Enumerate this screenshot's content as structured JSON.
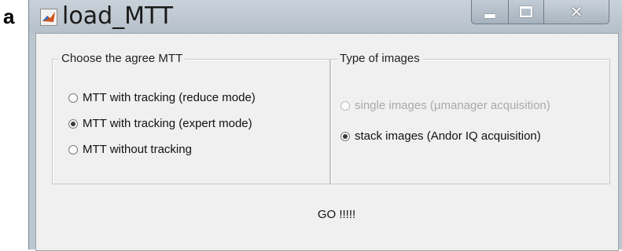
{
  "figure": {
    "panel_label": "a"
  },
  "window": {
    "title": "load_MTT"
  },
  "controls": {
    "minimize_icon": "minimize-icon",
    "maximize_icon": "maximize-icon",
    "close_icon": "close-icon"
  },
  "groups": {
    "mtt": {
      "legend": "Choose the agree MTT",
      "options": [
        {
          "label": "MTT with tracking (reduce mode)",
          "selected": false,
          "enabled": true
        },
        {
          "label": "MTT with tracking (expert mode)",
          "selected": true,
          "enabled": true
        },
        {
          "label": "MTT without tracking",
          "selected": false,
          "enabled": true
        }
      ]
    },
    "images": {
      "legend": "Type of images",
      "options": [
        {
          "label": "single images (µmanager acquisition)",
          "selected": false,
          "enabled": false
        },
        {
          "label": "stack images (Andor IQ acquisition)",
          "selected": true,
          "enabled": true
        }
      ]
    }
  },
  "go_button": {
    "label": "GO !!!!!"
  }
}
